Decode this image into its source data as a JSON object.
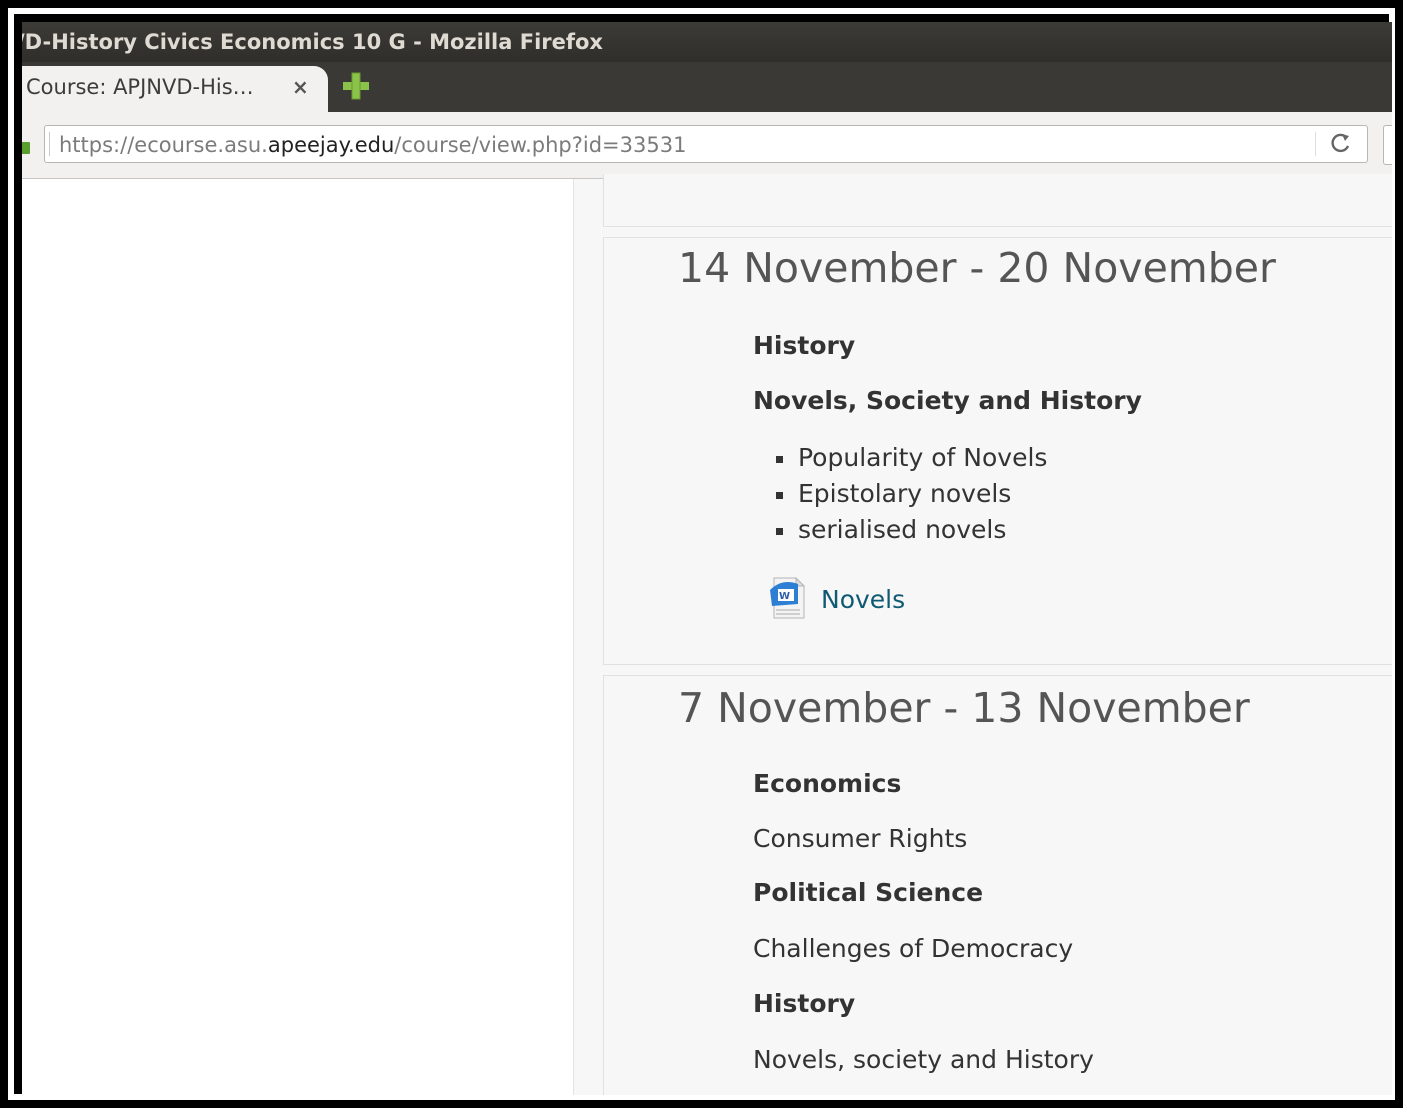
{
  "window": {
    "title": "/D-History Civics Economics 10 G - Mozilla Firefox"
  },
  "tabs": [
    {
      "label": "Course: APJNVD-His…",
      "close": "×"
    }
  ],
  "navbar": {
    "url_prefix": "https://ecourse.asu.",
    "url_host": "apeejay.edu",
    "url_path": "/course/view.php?id=33531",
    "reload_glyph": "C"
  },
  "sections": [
    {
      "title": "14 November - 20 November",
      "subject": "History",
      "topic": "Novels, Society and History",
      "bullets": [
        "Popularity of Novels",
        "Epistolary novels",
        "serialised novels"
      ],
      "resource": {
        "label": "Novels",
        "icon": "word-document-icon"
      }
    },
    {
      "title": "7 November - 13 November",
      "items": [
        {
          "text": "Economics",
          "bold": true
        },
        {
          "text": "Consumer Rights",
          "bold": false
        },
        {
          "text": "Political Science",
          "bold": true
        },
        {
          "text": "Challenges of Democracy",
          "bold": false
        },
        {
          "text": "History",
          "bold": true
        },
        {
          "text": "Novels, society and History",
          "bold": false
        }
      ]
    }
  ],
  "colors": {
    "titlebar": "#2f2e2b",
    "link": "#0f5a73",
    "newtab_plus": "#8bc34a"
  }
}
